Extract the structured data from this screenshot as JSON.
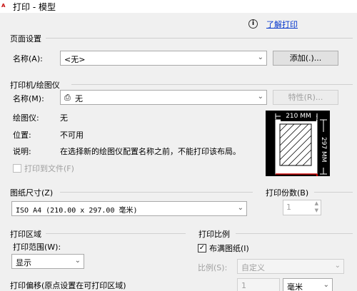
{
  "window": {
    "title": "打印 - 模型",
    "app_icon": "A",
    "help_link": "了解打印"
  },
  "page_setup": {
    "section_label": "页面设置",
    "name_label": "名称(A):",
    "name_value": "<无>",
    "add_button": "添加(.)..."
  },
  "printer": {
    "section_label": "打印机/绘图仪",
    "name_label": "名称(M):",
    "name_value": "无",
    "properties_button": "特性(R)...",
    "plotter_label": "绘图仪:",
    "plotter_value": "无",
    "location_label": "位置:",
    "location_value": "不可用",
    "description_label": "说明:",
    "description_value": "在选择新的绘图仪配置名称之前，不能打印该布局。",
    "print_to_file_label": "打印到文件(F)"
  },
  "preview": {
    "width_label": "210 MM",
    "height_label": "297 MM"
  },
  "paper_size": {
    "section_label": "图纸尺寸(Z)",
    "value": "ISO A4 (210.00 x 297.00 毫米)"
  },
  "copies": {
    "section_label": "打印份数(B)",
    "value": "1"
  },
  "plot_area": {
    "section_label": "打印区域",
    "range_label": "打印范围(W):",
    "range_value": "显示"
  },
  "plot_scale": {
    "section_label": "打印比例",
    "fit_label": "布满图纸(I)",
    "scale_label": "比例(S):",
    "scale_value": "自定义",
    "value": "1",
    "unit": "毫米"
  },
  "plot_offset": {
    "section_label": "打印偏移(原点设置在可打印区域)"
  }
}
